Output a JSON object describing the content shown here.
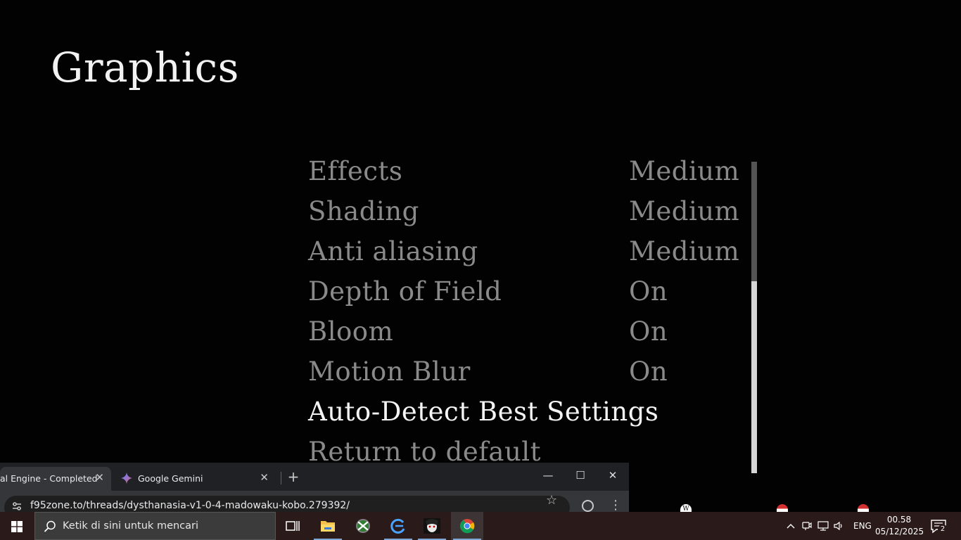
{
  "game": {
    "title": "Graphics",
    "settings": [
      {
        "label": "Effects",
        "value": "Medium"
      },
      {
        "label": "Shading",
        "value": "Medium"
      },
      {
        "label": "Anti aliasing",
        "value": "Medium"
      },
      {
        "label": "Depth of Field",
        "value": "On"
      },
      {
        "label": "Bloom",
        "value": "On"
      },
      {
        "label": "Motion Blur",
        "value": "On"
      },
      {
        "label": "Auto-Detect Best Settings",
        "value": ""
      },
      {
        "label": "Return to default",
        "value": ""
      }
    ],
    "selected_item": "Auto-Detect Best Settings",
    "colors": {
      "text_dim": "#8a8a8a",
      "text_active": "#f4f4f4",
      "background": "#020202"
    }
  },
  "browser": {
    "tabs": [
      {
        "title": "al Engine - Completed",
        "active": true
      },
      {
        "title": "Google Gemini",
        "active": false
      }
    ],
    "url": "f95zone.to/threads/dysthanasia-v1-0-4-madowaku-kobo.279392/",
    "icons": {
      "new_tab": "plus-icon",
      "bookmark": "star-icon",
      "profile": "profile-icon",
      "menu": "kebab-icon"
    }
  },
  "taskbar": {
    "search_placeholder": "Ketik di sini untuk mencari",
    "apps": [
      "task-view",
      "file-explorer",
      "xbox",
      "browser",
      "game",
      "chrome"
    ],
    "language": "ENG",
    "time": "00.58",
    "date": "05/12/2025",
    "notification_count": "2",
    "colors": {
      "background": "#2b1a1a",
      "accent": "#7fa8d6"
    }
  }
}
